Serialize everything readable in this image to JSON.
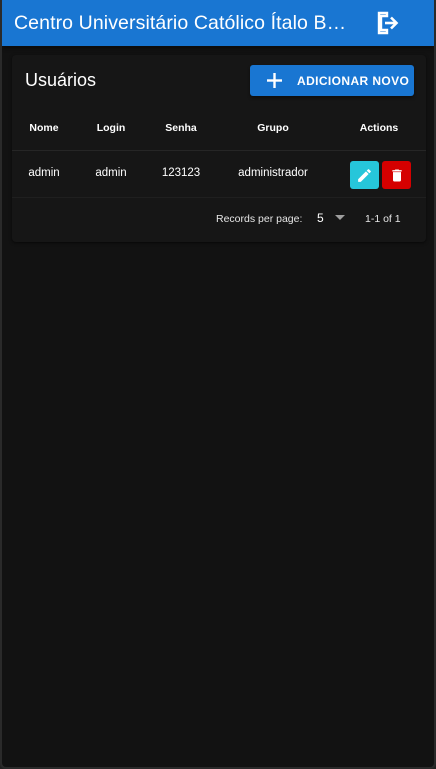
{
  "appbar": {
    "title": "Centro Universitário Católico Ítalo Brasileiro",
    "logout_icon": "logout-icon"
  },
  "page": {
    "title": "Usuários",
    "add_button_label": "ADICIONAR NOVO",
    "add_icon": "plus-icon"
  },
  "table": {
    "headers": {
      "nome": "Nome",
      "login": "Login",
      "senha": "Senha",
      "grupo": "Grupo",
      "actions": "Actions"
    },
    "rows": [
      {
        "nome": "admin",
        "login": "admin",
        "senha": "123123",
        "grupo": "administrador",
        "edit_icon": "pencil-icon",
        "delete_icon": "trash-icon"
      }
    ]
  },
  "pagination": {
    "rows_per_page_label": "Records per page:",
    "rows_per_page_value": "5",
    "range_text": "1-1 of 1"
  },
  "colors": {
    "primary": "#1976d2",
    "edit": "#26c6da",
    "delete": "#d50000",
    "background": "#121212",
    "card": "#161616"
  }
}
